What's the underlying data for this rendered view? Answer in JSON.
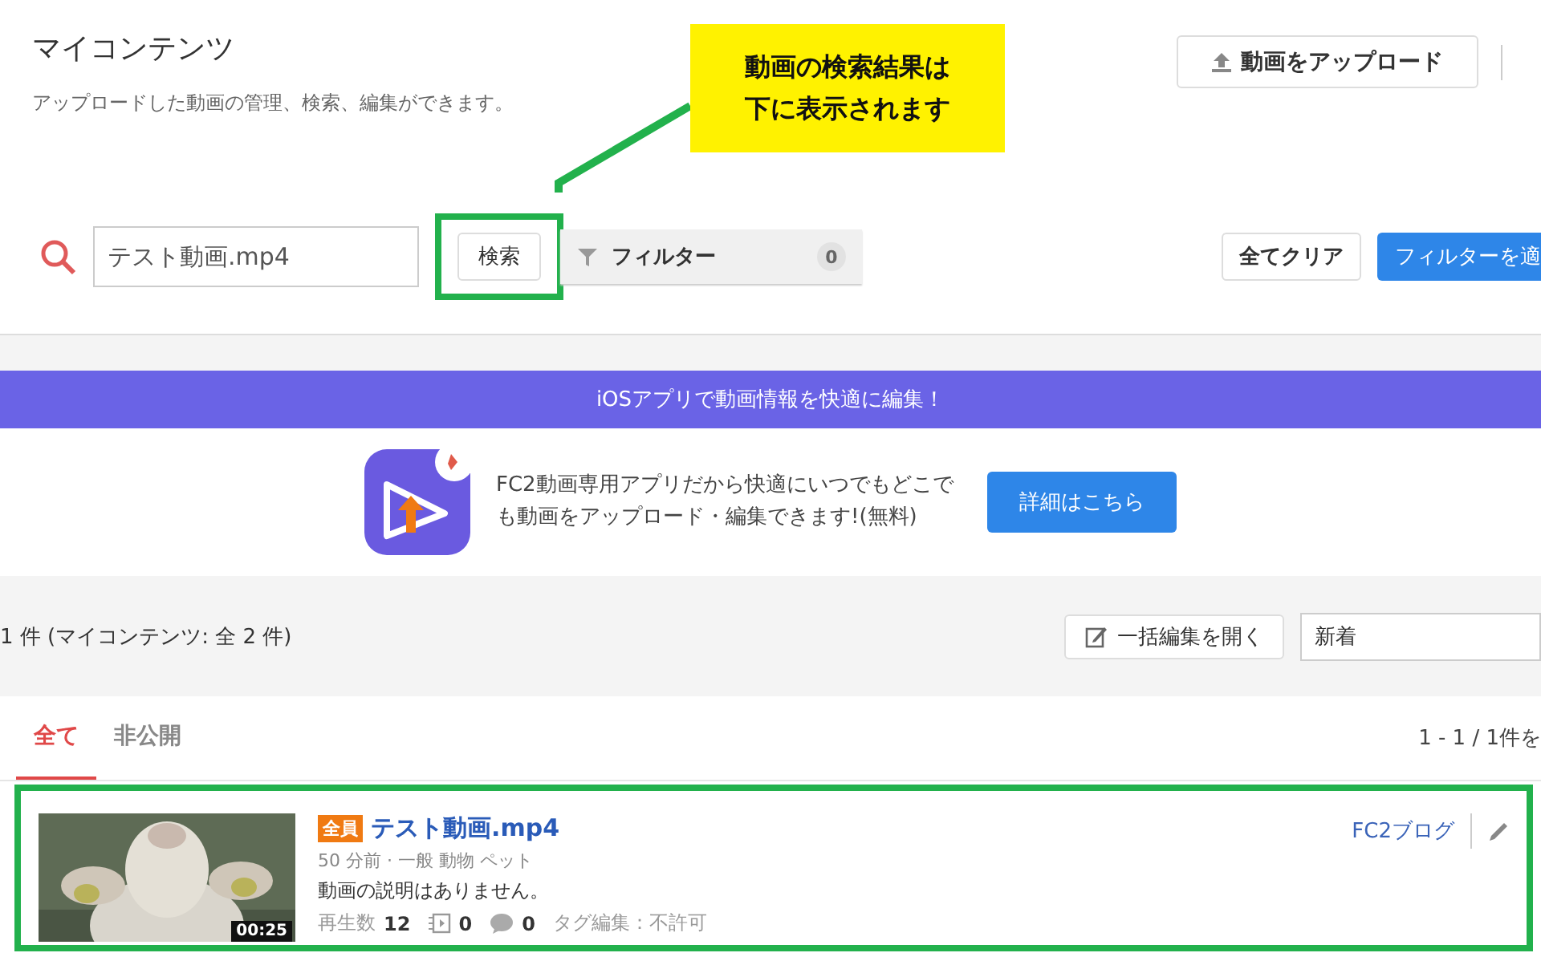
{
  "header": {
    "title": "マイコンテンツ",
    "subtitle": "アップロードした動画の管理、検索、編集ができます。",
    "upload_button": "動画をアップロード"
  },
  "callout": {
    "lines": [
      "動画の検索結果は",
      "下に表示されます"
    ]
  },
  "search": {
    "value": "テスト動画.mp4",
    "button": "検索",
    "highlighted": true
  },
  "filter": {
    "label": "フィルター",
    "count": "0"
  },
  "actions": [
    {
      "label": "全てクリア",
      "kind": "secondary"
    },
    {
      "label": "フィルターを適",
      "kind": "primary"
    }
  ],
  "banner": {
    "text": "iOSアプリで動画情報を快適に編集！"
  },
  "promo": {
    "text": "FC2動画専用アプリだから快適にいつでもどこでも動画をアップロード・編集できます!(無料)",
    "button": "詳細はこちら"
  },
  "results": {
    "count": "1 件 (マイコンテンツ: 全 2 件)",
    "bulk_edit": "一括編集を開く",
    "sort": "新着"
  },
  "tabs": [
    {
      "label": "全て",
      "selected": true
    },
    {
      "label": "非公開",
      "selected": false
    }
  ],
  "pagination": "1 - 1 / 1件を",
  "videos": [
    {
      "duration": "00:25",
      "badge": "全員",
      "title": "テスト動画.mp4",
      "meta": "50 分前 · 一般 動物 ペット",
      "description": "動画の説明はありません。",
      "views_label": "再生数",
      "views": "12",
      "playlists": "0",
      "comments": "0",
      "tag_edit": "タグ編集：不許可",
      "blog_link": "FC2ブログ",
      "highlighted": true
    }
  ]
}
